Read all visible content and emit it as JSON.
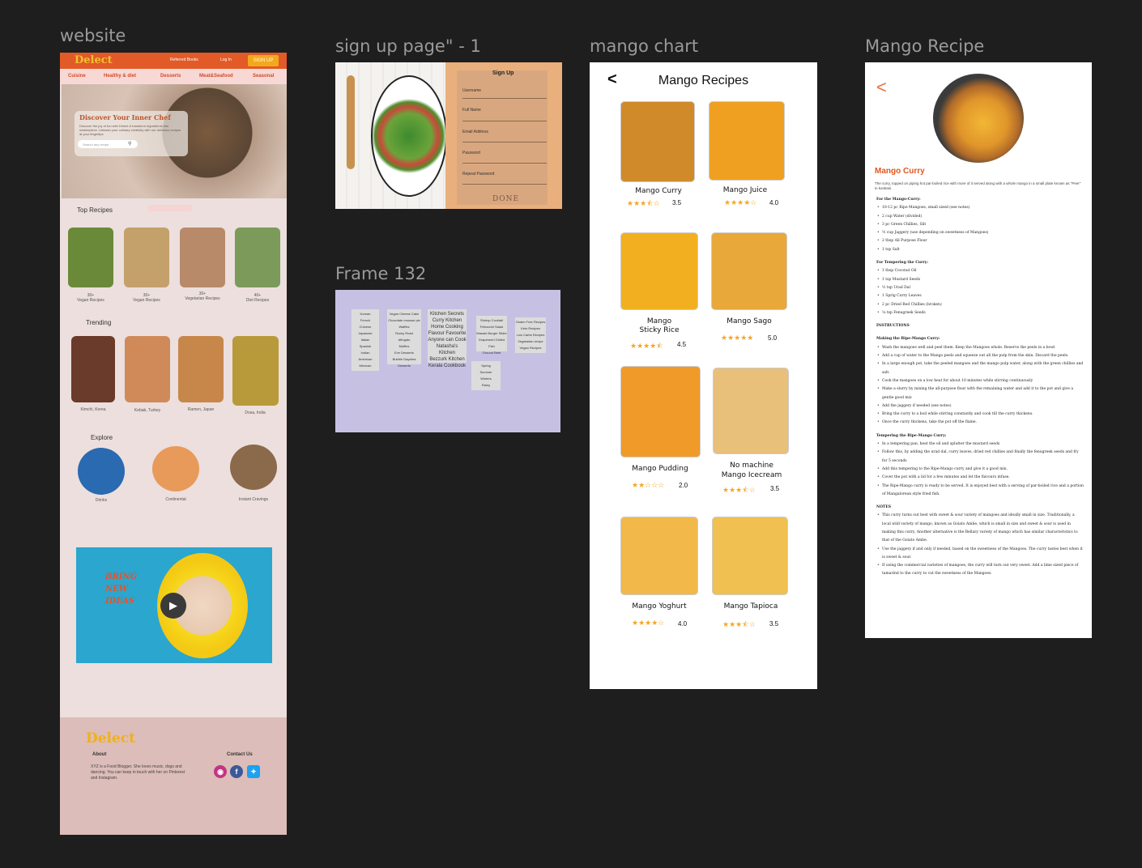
{
  "frames": {
    "website": "website",
    "signup": "sign up page\" - 1",
    "mango_chart": "mango chart",
    "frame132": "Frame 132",
    "mango_recipe": "Mango Recipe"
  },
  "website": {
    "logo": "Delect",
    "nav": [
      "Referred Books",
      "Log In"
    ],
    "signup_button": "SIGN UP",
    "categories": [
      "Cuisine",
      "Healthy & diet",
      "Desserts",
      "Meat&Seafood",
      "Seasonal"
    ],
    "hero": {
      "title": "Discover Your Inner Chef",
      "subtitle": "Discover the joy of fun with Delect & transform ingredients into masterpiece. Unleash your culinary creativity with our delicious recipes at your fingertips",
      "search_placeholder": "Search any recipe"
    },
    "top_recipes": {
      "title": "Top Recipes",
      "items": [
        {
          "count": "30+",
          "label": "Vegan Recipes",
          "color": "#6a8a3a"
        },
        {
          "count": "30+",
          "label": "Vegan Recipes",
          "color": "#c4a06a"
        },
        {
          "count": "30+",
          "label": "Vegetarian Recipes",
          "color": "#b88a6a"
        },
        {
          "count": "40+",
          "label": "Diet Recipes",
          "color": "#7c9a5a"
        }
      ]
    },
    "trending": {
      "title": "Trending",
      "items": [
        {
          "label": "Kimchi, Korea",
          "color": "#6a3a2a"
        },
        {
          "label": "Kebab, Turkey",
          "color": "#d08a5a"
        },
        {
          "label": "Ramen, Japan",
          "color": "#c8874a"
        },
        {
          "label": "Dosa, India",
          "color": "#b89a3a"
        }
      ]
    },
    "explore": {
      "title": "Explore",
      "items": [
        {
          "label": "Drinks",
          "color": "#2a6ab0"
        },
        {
          "label": "Continental",
          "color": "#e89a5a"
        },
        {
          "label": "Instant Cravings",
          "color": "#8a6a4a"
        }
      ]
    },
    "video": {
      "text_lines": [
        "BRING",
        "NEW",
        "IDEAS"
      ]
    },
    "footer": {
      "logo": "Delect",
      "about_title": "About",
      "about_text": "XYZ is a Food Blogger. She loves music, dogs and dancing. You can keep in touch with her on Pinterest and Instagram.",
      "contact_title": "Contact Us",
      "social_icons": [
        "instagram-icon",
        "facebook-icon",
        "twitter-icon"
      ]
    }
  },
  "signup": {
    "title": "Sign Up",
    "fields": [
      "Username",
      "Full Name",
      "Email Address",
      "Password",
      "Repeat Password"
    ],
    "done": "DONE"
  },
  "frame132": {
    "cards": [
      [
        "Korean",
        "French",
        "Chinese",
        "Japanese",
        "Italian",
        "Spanish",
        "Indian",
        "American",
        "Mexican"
      ],
      [
        "Vegan Cheese Cake",
        "Chocolate mousse pie",
        "Waffles",
        "Rocky Road",
        "Affogato",
        "Muffins",
        "Eve Desserts",
        "Bubble Daydrea Desserts"
      ],
      [
        "Kitchen Secrets",
        "Curry Kitchen",
        "Home Cooking",
        "Flavour Favourite",
        "Anyone can Cook",
        "Natasha's Kitchen",
        "Bezzurk Kitchen",
        "Kerala Cookbook"
      ],
      [
        "Shrimp Cocktail",
        "Fettuccini Salad",
        "Wasabi Burger Slider",
        "Grapeseed Grilled Fish",
        "Ground Beef"
      ],
      [
        "Gluten Free Recipes",
        "Keto Recipes",
        "Low Carbs Recipes",
        "Vegetarian recipe",
        "Vegan Recipes"
      ],
      [
        "Spring",
        "Summer",
        "Winters",
        "Rainy"
      ]
    ]
  },
  "mango_chart": {
    "title": "Mango Recipes",
    "back_icon": "chevron-left-icon",
    "items": [
      {
        "name": "Mango Curry",
        "stars": "★★★⯪☆",
        "rating": "3.5",
        "color": "#d08a2a"
      },
      {
        "name": "Mango Juice",
        "stars": "★★★★☆",
        "rating": "4.0",
        "color": "#f0a020"
      },
      {
        "name": "Mango\nSticky Rice",
        "stars": "★★★★⯪",
        "rating": "4.5",
        "color": "#f2b020"
      },
      {
        "name": "Mango Sago",
        "stars": "★★★★★",
        "rating": "5.0",
        "color": "#e8a83a"
      },
      {
        "name": "Mango Pudding",
        "stars": "★★☆☆☆",
        "rating": "2.0",
        "color": "#f09a2a"
      },
      {
        "name": "No machine\nMango Icecream",
        "stars": "★★★⯪☆",
        "rating": "3.5",
        "color": "#e8c07a"
      },
      {
        "name": "Mango Yoghurt",
        "stars": "★★★★☆",
        "rating": "4.0",
        "color": "#f2b84a"
      },
      {
        "name": "Mango Tapioca",
        "stars": "★★★⯪☆",
        "rating": "3.5",
        "color": "#f0c050"
      }
    ]
  },
  "mango_recipe": {
    "back_icon": "chevron-left-icon",
    "title": "Mango Curry",
    "intro": "The curry, topped on piping hot par-boiled rice with more of it served along with a whole mango in a small plate known as \"Peer\" in konkani.",
    "sections": [
      {
        "heading": "For the Mango-Curry:",
        "items": [
          "10-12 pc Ripe Mangoes, small sized (see notes)",
          "2 cup Water (divided)",
          "3 pc Green Chillies, Slit",
          "½ cup Jaggery (use depending on sweetness of Mangoes)",
          "2 tbsp All Purpose Flour",
          "1 tsp Salt"
        ]
      },
      {
        "heading": "For Tempering the Curry:",
        "items": [
          "1 tbsp Coconut Oil",
          "1 tsp Mustard Seeds",
          "½ tsp Urad Dal",
          "1 Sprig Curry Leaves",
          "2 pc Dried Red Chillies (broken)",
          "¼ tsp Fenugreek Seeds"
        ]
      },
      {
        "heading": "INSTRUCTIONS",
        "items": []
      },
      {
        "heading": "Making the Ripe-Mango Curry:",
        "items": [
          "Wash the mangoes well and peel them. Keep the Mangoes whole. Reserve the peels in a bowl",
          "Add a cup of water to the Mango peels and squeeze out all the pulp from the skin. Discard the peels.",
          "In a large enough pot, take the peeled mangoes and the mango pulp water, along with the green chillies and salt.",
          "Cook the mangoes on a low heat for about 10 minutes while stirring continuously",
          "Make a slurry by mixing the all-purpose flour with the remaining water and add it to the pot and give a gentle good mix",
          "Add the jaggery if needed (see notes)",
          "Bring the curry to a boil while stirring constantly and cook till the curry thickens.",
          "Once the curry thickens, take the pot off the flame."
        ]
      },
      {
        "heading": "Tempering the Ripe-Mango Curry:",
        "items": [
          "In a tempering pan, heat the oil and splutter the mustard seeds",
          "Follow this, by adding the urad dal, curry leaves, dried red chillies and finally the fenugreek seeds and fry for 5 seconds",
          "Add this tempering to the Ripe-Mango curry and give it a good mix.",
          "Cover the pot with a lid for a few minutes and let the flavours infuse.",
          "The Ripe-Mango curry is ready to be served. It is enjoyed best with a serving of par-boiled rice and a portion of Mangalorean style fried fish."
        ]
      },
      {
        "heading": "NOTES",
        "items": [
          "This curry turns out best with sweet & sour variety of mangoes and ideally small in size. Traditionally, a local wild variety of mango, known as Goiato Ambe, which is small in size and sweet & sour is used in making this curry. Another alternative is the Bellary variety of mango which has similar characteristics to that of the Goiato Ambe.",
          "Use the jaggery if and only if needed, based on the sweetness of the Mangoes. The curry tastes best when it is sweet & sour.",
          "If using the commercial varieties of mangoes, the curry will turn out very sweet. Add a lime sized piece of tamarind to the curry to cut the sweetness of the Mangoes."
        ]
      }
    ]
  }
}
